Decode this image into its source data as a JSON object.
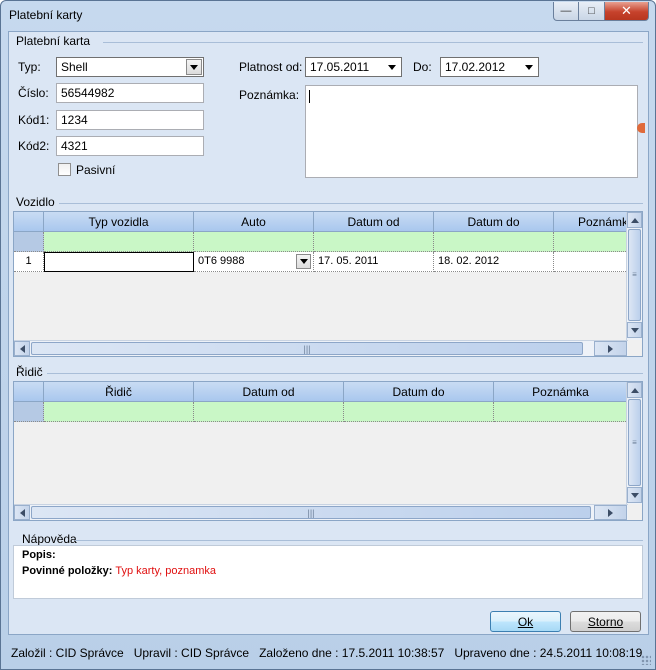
{
  "window": {
    "title": "Platební karty",
    "buttons": {
      "minimize": "—",
      "maximize": "□",
      "close": "✕"
    }
  },
  "card_group": {
    "title": "Platební karta",
    "type_label": "Typ:",
    "type_value": "Shell",
    "number_label": "Číslo:",
    "number_value": "56544982",
    "code1_label": "Kód1:",
    "code1_value": "1234",
    "code2_label": "Kód2:",
    "code2_value": "4321",
    "passive_label": "Pasivní",
    "passive_checked": false,
    "valid_from_label": "Platnost od:",
    "valid_from_value": "17.05.2011",
    "valid_to_label": "Do:",
    "valid_to_value": "17.02.2012",
    "note_label": "Poznámka:",
    "note_value": ""
  },
  "vehicle_group": {
    "title": "Vozidlo",
    "columns": [
      "Typ vozidla",
      "Auto",
      "Datum od",
      "Datum do",
      "Poznámka"
    ],
    "rows": [
      {
        "row_number": "1",
        "vehicle_type": "",
        "car": "0T6 9988",
        "date_from": "17. 05. 2011",
        "date_to": "18. 02. 2012",
        "note": ""
      }
    ]
  },
  "driver_group": {
    "title": "Řidič",
    "columns": [
      "Řidič",
      "Datum od",
      "Datum do",
      "Poznámka"
    ],
    "rows": []
  },
  "help_group": {
    "title": "Nápověda",
    "description_label": "Popis:",
    "required_label": "Povinné položky:",
    "required_value": "Typ karty, poznamka"
  },
  "actions": {
    "ok_label": "Ok",
    "cancel_label": "Storno"
  },
  "status_bar": {
    "created_by": "Založil : CID Správce",
    "modified_by": "Upravil : CID Správce",
    "created_at": "Založeno dne : 17.5.2011 10:38:57",
    "modified_at": "Upraveno dne : 24.5.2011 10:08:19"
  },
  "colors": {
    "new_row": "#c9f7c6",
    "header": "#a9c7ee",
    "required_text": "#e01010",
    "client_bg": "#dbe6f4"
  }
}
